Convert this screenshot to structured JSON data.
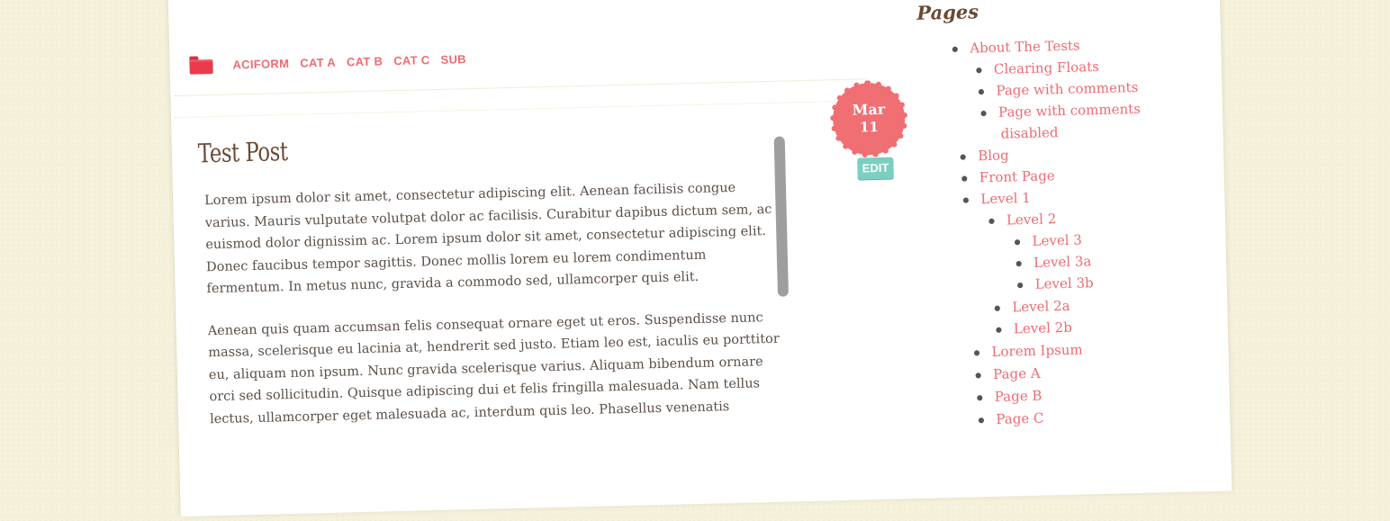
{
  "nav": {
    "links": [
      "ACIFORM",
      "CAT A",
      "CAT B",
      "CAT C",
      "SUB"
    ]
  },
  "post": {
    "title": "Test Post",
    "paragraphs": [
      "Lorem ipsum dolor sit amet, consectetur adipiscing elit. Aenean facilisis congue varius. Mauris vulputate volutpat dolor ac facilisis. Curabitur dapibus dictum sem, ac euismod dolor dignissim ac. Lorem ipsum dolor sit amet, consectetur adipiscing elit. Donec faucibus tempor sagittis. Donec mollis lorem eu lorem condimentum fermentum. In metus nunc, gravida a commodo sed, ullamcorper quis elit.",
      "Aenean quis quam accumsan felis consequat ornare eget ut eros. Suspendisse nunc massa, scelerisque eu lacinia at, hendrerit sed justo. Etiam leo est, iaculis eu porttitor eu, aliquam non ipsum. Nunc gravida scelerisque varius. Aliquam bibendum ornare orci sed sollicitudin. Quisque adipiscing dui et felis fringilla malesuada. Nam tellus lectus, ullamcorper eget malesuada ac, interdum quis leo. Phasellus venenatis gravida viverra. Sed consequat hendrerit lectus ac dignissim. Phasellus vel nisi libero, quis"
    ],
    "date_month": "Mar",
    "date_day": "11",
    "edit_label": "EDIT"
  },
  "sidebar": {
    "title": "Pages",
    "pages": [
      "About The Tests",
      "Clearing Floats",
      "Page with comments",
      "Page with comments",
      "disabled",
      "Blog",
      "Front Page",
      "Level 1",
      "Level 2",
      "Level 3",
      "Level 3a",
      "Level 3b",
      "Level 2a",
      "Level 2b",
      "Lorem Ipsum",
      "Page A",
      "Page B",
      "Page C"
    ]
  },
  "colors": {
    "accent": "#ee6b72",
    "badge": "#ef6f73",
    "edit": "#7ccfc0",
    "title": "#6a4a36",
    "body_text": "#5b5049",
    "background": "#f5f1da"
  }
}
